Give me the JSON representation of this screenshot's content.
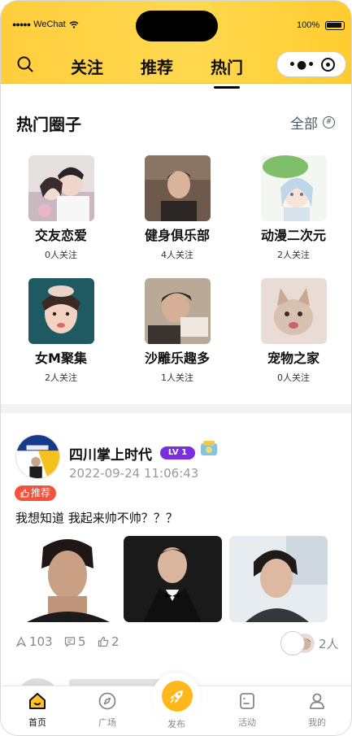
{
  "status_bar": {
    "carrier": "WeChat",
    "battery": "100%"
  },
  "nav": {
    "tabs": [
      {
        "label": "关注"
      },
      {
        "label": "推荐"
      },
      {
        "label": "热门"
      }
    ],
    "active_tab": "热门"
  },
  "circles": {
    "title": "热门圈子",
    "all_label": "全部",
    "items": [
      {
        "name": "交友恋爱",
        "followers": "0人关注"
      },
      {
        "name": "健身俱乐部",
        "followers": "4人关注"
      },
      {
        "name": "动漫二次元",
        "followers": "2人关注"
      },
      {
        "name": "女M聚集",
        "followers": "2人关注"
      },
      {
        "name": "沙雕乐趣多",
        "followers": "1人关注"
      },
      {
        "name": "宠物之家",
        "followers": "0人关注"
      }
    ]
  },
  "post": {
    "author": "四川掌上时代",
    "level": "LV 1",
    "time": "2022-09-24 11:06:43",
    "badge": "推荐",
    "text": "我想知道 我起来帅不帅？？？",
    "reposts": "103",
    "comments": "5",
    "likes": "2",
    "viewers": "2人"
  },
  "tabbar": {
    "items": [
      {
        "label": "首页",
        "icon": "home-icon"
      },
      {
        "label": "广场",
        "icon": "compass-icon"
      },
      {
        "label": "发布",
        "icon": "rocket-icon"
      },
      {
        "label": "活动",
        "icon": "activity-icon"
      },
      {
        "label": "我的",
        "icon": "profile-icon"
      }
    ]
  },
  "colors": {
    "header": "#ffd23f",
    "accent": "#ffb71b",
    "badge": "#f4523b",
    "level": "#7a2ee0"
  }
}
